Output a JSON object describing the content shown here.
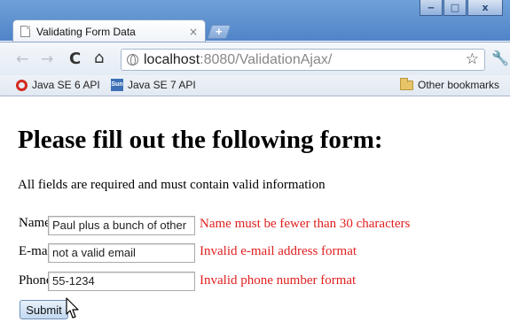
{
  "window": {
    "minimize_glyph": "‒",
    "maximize_glyph": "□",
    "close_glyph": "x"
  },
  "tab": {
    "title": "Validating Form Data",
    "close_glyph": "×",
    "new_tab_glyph": "+"
  },
  "toolbar": {
    "back_glyph": "←",
    "forward_glyph": "→",
    "reload_glyph": "C",
    "home_glyph": "⌂",
    "url_host": "localhost",
    "url_rest": ":8080/ValidationAjax/",
    "star_glyph": "☆",
    "wrench_glyph": "🔧"
  },
  "bookmarks": {
    "items": [
      {
        "label": "Java SE 6 API",
        "icon": "oracle-icon"
      },
      {
        "label": "Java SE 7 API",
        "icon": "sun-icon"
      }
    ],
    "sun_icon_text": "Sun",
    "other_label": "Other bookmarks"
  },
  "page": {
    "heading": "Please fill out the following form:",
    "intro": "All fields are required and must contain valid information",
    "form": {
      "name": {
        "label": "Name:",
        "value": "Paul plus a bunch of other",
        "error": "Name must be fewer than 30 characters"
      },
      "email": {
        "label": "E-mail:",
        "value": "not a valid email",
        "error": "Invalid e-mail address format"
      },
      "phone": {
        "label": "Phone:",
        "value": "55-1234",
        "error": "Invalid phone number format"
      },
      "submit_label": "Submit"
    }
  },
  "colors": {
    "error": "#e02020",
    "titlebar": "#4f84c8"
  }
}
